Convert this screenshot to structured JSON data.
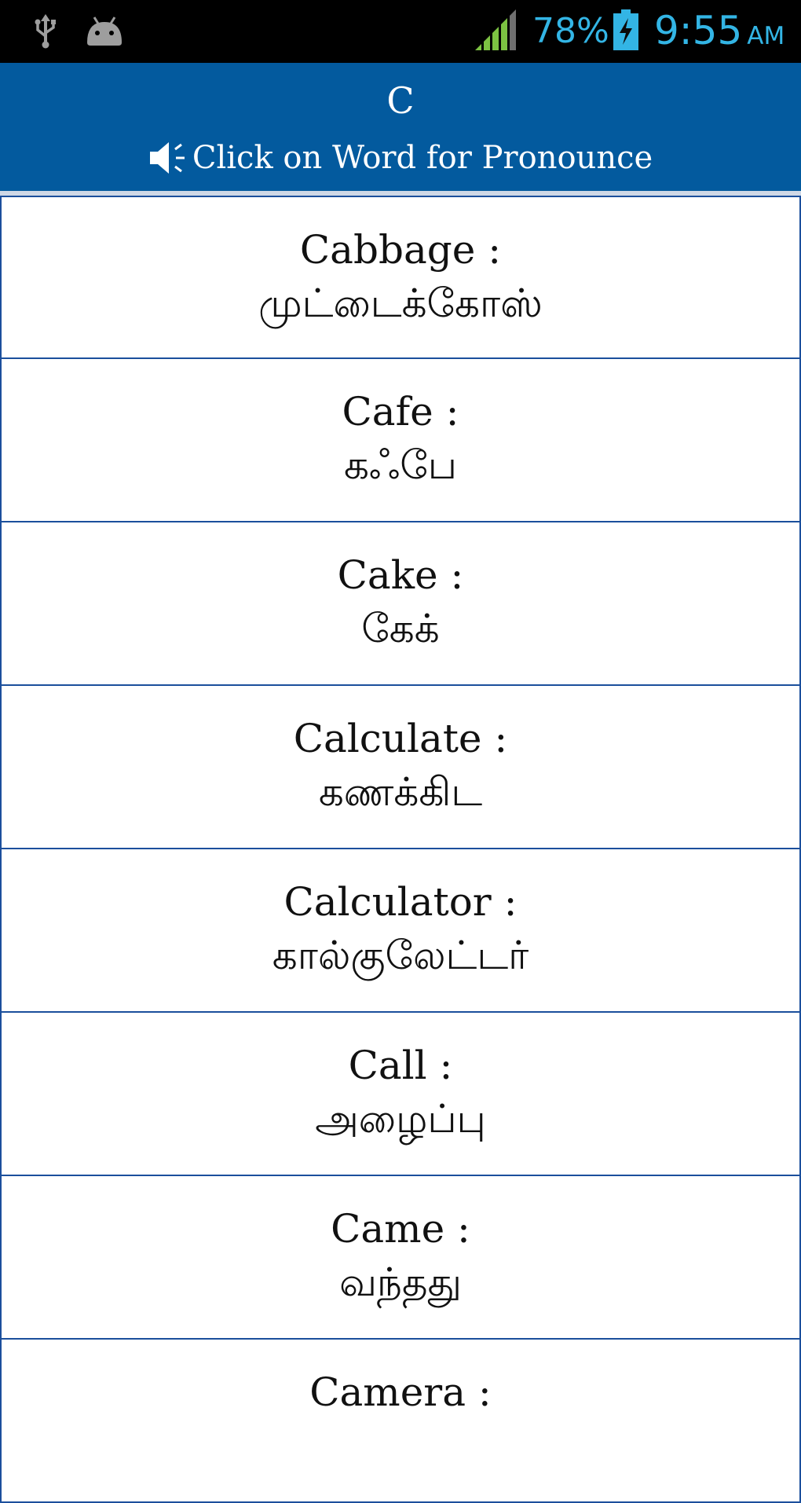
{
  "status_bar": {
    "battery_percent": "78%",
    "time": "9:55",
    "ampm": "AM",
    "text_color": "#33b5e5",
    "signal_color": "#7cc242",
    "icons": [
      "usb-icon",
      "android-debug-icon",
      "signal-icon",
      "battery-charging-icon"
    ]
  },
  "header": {
    "letter": "C",
    "hint": "Click on Word for Pronounce",
    "background": "#035a9e",
    "icon": "speaker-icon"
  },
  "words": [
    {
      "english": "Cabbage :",
      "tamil": "முட்டைக்கோஸ்"
    },
    {
      "english": "Cafe :",
      "tamil": "கஃபே"
    },
    {
      "english": "Cake :",
      "tamil": "கேக்"
    },
    {
      "english": "Calculate :",
      "tamil": "கணக்கிட"
    },
    {
      "english": "Calculator :",
      "tamil": "கால்குலேட்டர்"
    },
    {
      "english": "Call :",
      "tamil": "அழைப்பு"
    },
    {
      "english": "Came :",
      "tamil": "வந்தது"
    },
    {
      "english": "Camera :",
      "tamil": ""
    }
  ],
  "colors": {
    "row_border": "#1b4f9c",
    "text": "#111111"
  }
}
